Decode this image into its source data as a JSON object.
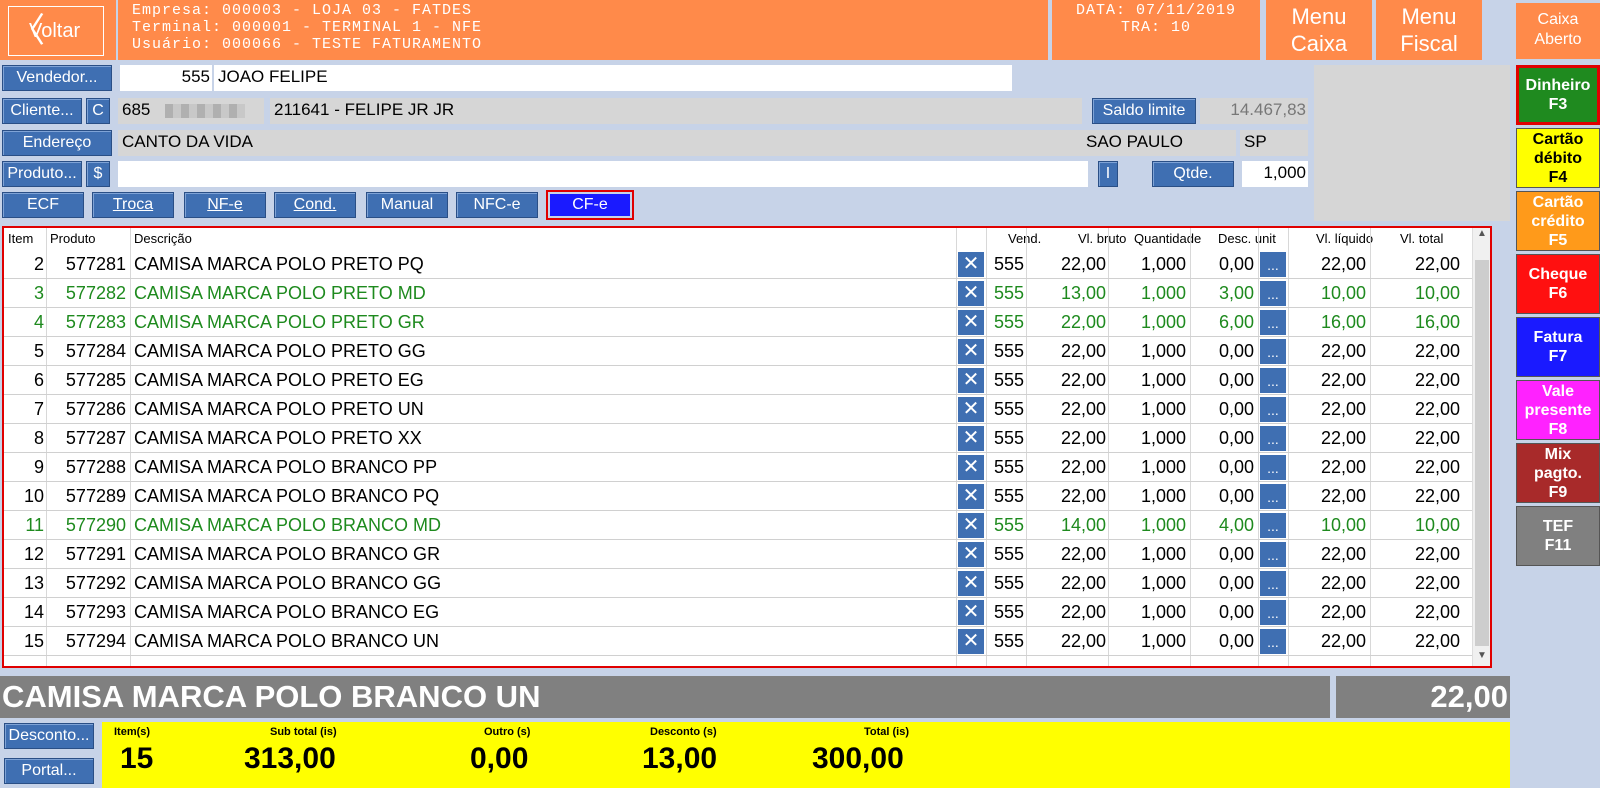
{
  "header": {
    "back_label": "Voltar",
    "company_line": "Empresa: 000003 - LOJA 03 - FATDES",
    "terminal_line": "Terminal: 000001 - TERMINAL 1 - NFE",
    "user_line": "Usuário: 000066 - TESTE FATURAMENTO",
    "date_line": "DATA: 07/11/2019",
    "tra_line": "TRA: 10",
    "menu_caixa_1": "Menu",
    "menu_caixa_2": "Caixa",
    "menu_fiscal_1": "Menu",
    "menu_fiscal_2": "Fiscal",
    "caixa_status_1": "Caixa",
    "caixa_status_2": "Aberto"
  },
  "form": {
    "vendedor_btn": "Vendedor...",
    "vendedor_code": "555",
    "vendedor_name": "JOAO FELIPE",
    "cliente_btn": "Cliente...",
    "cliente_c_btn": "C",
    "cliente_code": "685",
    "cliente_name": "211641 - FELIPE JR JR",
    "saldo_btn": "Saldo limite",
    "saldo_value": "14.467,83",
    "endereco_btn": "Endereço",
    "endereco": "CANTO DA VIDA",
    "cidade": "SAO PAULO",
    "uf": "SP",
    "produto_btn": "Produto...",
    "produto_dollar_btn": "$",
    "produto_value": "",
    "i_btn": "I",
    "qtde_btn": "Qtde.",
    "qtde_value": "1,000"
  },
  "modes": [
    "ECF",
    "Troca",
    "NF-e",
    "Cond.",
    "Manual",
    "NFC-e",
    "CF-e"
  ],
  "grid": {
    "headers": [
      "Item",
      "Produto",
      "Descrição",
      "Vend.",
      "Vl. bruto",
      "Quantidade",
      "Desc. unit",
      "Vl. líquido",
      "Vl. total"
    ],
    "rows": [
      {
        "item": "2",
        "produto": "577281",
        "descricao": "CAMISA MARCA POLO PRETO PQ",
        "vend": "555",
        "bruto": "22,00",
        "qtd": "1,000",
        "desc": "0,00",
        "liquido": "22,00",
        "total": "22,00",
        "green": false
      },
      {
        "item": "3",
        "produto": "577282",
        "descricao": "CAMISA MARCA POLO PRETO MD",
        "vend": "555",
        "bruto": "13,00",
        "qtd": "1,000",
        "desc": "3,00",
        "liquido": "10,00",
        "total": "10,00",
        "green": true
      },
      {
        "item": "4",
        "produto": "577283",
        "descricao": "CAMISA MARCA POLO PRETO GR",
        "vend": "555",
        "bruto": "22,00",
        "qtd": "1,000",
        "desc": "6,00",
        "liquido": "16,00",
        "total": "16,00",
        "green": true
      },
      {
        "item": "5",
        "produto": "577284",
        "descricao": "CAMISA MARCA POLO PRETO GG",
        "vend": "555",
        "bruto": "22,00",
        "qtd": "1,000",
        "desc": "0,00",
        "liquido": "22,00",
        "total": "22,00",
        "green": false
      },
      {
        "item": "6",
        "produto": "577285",
        "descricao": "CAMISA MARCA POLO PRETO EG",
        "vend": "555",
        "bruto": "22,00",
        "qtd": "1,000",
        "desc": "0,00",
        "liquido": "22,00",
        "total": "22,00",
        "green": false
      },
      {
        "item": "7",
        "produto": "577286",
        "descricao": "CAMISA MARCA POLO PRETO UN",
        "vend": "555",
        "bruto": "22,00",
        "qtd": "1,000",
        "desc": "0,00",
        "liquido": "22,00",
        "total": "22,00",
        "green": false
      },
      {
        "item": "8",
        "produto": "577287",
        "descricao": "CAMISA MARCA POLO PRETO XX",
        "vend": "555",
        "bruto": "22,00",
        "qtd": "1,000",
        "desc": "0,00",
        "liquido": "22,00",
        "total": "22,00",
        "green": false
      },
      {
        "item": "9",
        "produto": "577288",
        "descricao": "CAMISA MARCA POLO BRANCO PP",
        "vend": "555",
        "bruto": "22,00",
        "qtd": "1,000",
        "desc": "0,00",
        "liquido": "22,00",
        "total": "22,00",
        "green": false
      },
      {
        "item": "10",
        "produto": "577289",
        "descricao": "CAMISA MARCA POLO BRANCO PQ",
        "vend": "555",
        "bruto": "22,00",
        "qtd": "1,000",
        "desc": "0,00",
        "liquido": "22,00",
        "total": "22,00",
        "green": false
      },
      {
        "item": "11",
        "produto": "577290",
        "descricao": "CAMISA MARCA POLO BRANCO MD",
        "vend": "555",
        "bruto": "14,00",
        "qtd": "1,000",
        "desc": "4,00",
        "liquido": "10,00",
        "total": "10,00",
        "green": true
      },
      {
        "item": "12",
        "produto": "577291",
        "descricao": "CAMISA MARCA POLO BRANCO GR",
        "vend": "555",
        "bruto": "22,00",
        "qtd": "1,000",
        "desc": "0,00",
        "liquido": "22,00",
        "total": "22,00",
        "green": false
      },
      {
        "item": "13",
        "produto": "577292",
        "descricao": "CAMISA MARCA POLO BRANCO GG",
        "vend": "555",
        "bruto": "22,00",
        "qtd": "1,000",
        "desc": "0,00",
        "liquido": "22,00",
        "total": "22,00",
        "green": false
      },
      {
        "item": "14",
        "produto": "577293",
        "descricao": "CAMISA MARCA POLO BRANCO EG",
        "vend": "555",
        "bruto": "22,00",
        "qtd": "1,000",
        "desc": "0,00",
        "liquido": "22,00",
        "total": "22,00",
        "green": false
      },
      {
        "item": "15",
        "produto": "577294",
        "descricao": "CAMISA MARCA POLO BRANCO UN",
        "vend": "555",
        "bruto": "22,00",
        "qtd": "1,000",
        "desc": "0,00",
        "liquido": "22,00",
        "total": "22,00",
        "green": false
      }
    ],
    "remove_glyph": "✕",
    "more_glyph": "..."
  },
  "payments": [
    {
      "label1": "Dinheiro",
      "label2": "F3",
      "label3": "",
      "color": "#1f8a1f"
    },
    {
      "label1": "Cartão",
      "label2": "débito",
      "label3": "F4",
      "color": "#ffff00"
    },
    {
      "label1": "Cartão",
      "label2": "crédito",
      "label3": "F5",
      "color": "#ff9a1a"
    },
    {
      "label1": "Cheque",
      "label2": "F6",
      "label3": "",
      "color": "#ff1010"
    },
    {
      "label1": "Fatura",
      "label2": "F7",
      "label3": "",
      "color": "#1a1aff"
    },
    {
      "label1": "Vale",
      "label2": "presente",
      "label3": "F8",
      "color": "#ff22ff"
    },
    {
      "label1": "Mix",
      "label2": "pagto.",
      "label3": "F9",
      "color": "#a82a2a"
    },
    {
      "label1": "TEF",
      "label2": "F11",
      "label3": "",
      "color": "#808080"
    }
  ],
  "current": {
    "description": "CAMISA MARCA POLO BRANCO UN",
    "total": "22,00"
  },
  "footer": {
    "desconto_btn": "Desconto...",
    "portal_btn": "Portal...",
    "items_label": "Item(s)",
    "items_value": "15",
    "subtotal_label": "Sub total (is)",
    "subtotal_value": "313,00",
    "outro_label": "Outro (s)",
    "outro_value": "0,00",
    "desconto_label": "Desconto (s)",
    "desconto_value": "13,00",
    "total_label": "Total (is)",
    "total_value": "300,00"
  }
}
